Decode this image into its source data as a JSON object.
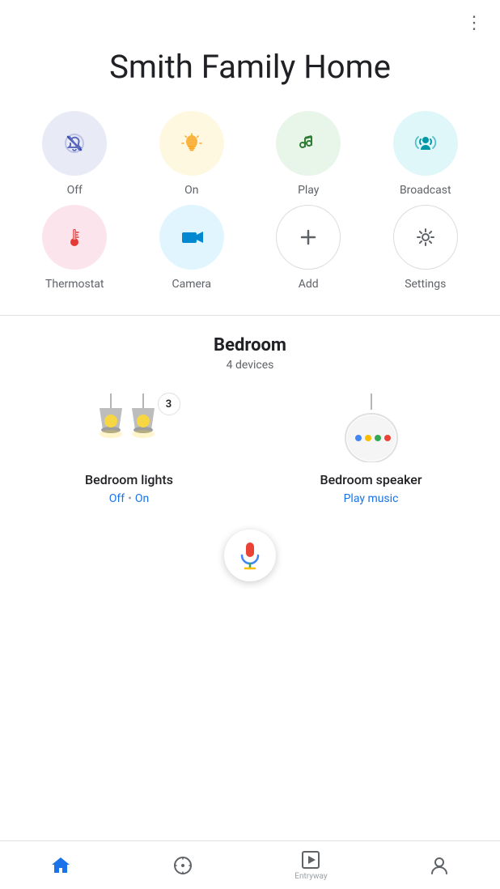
{
  "app": {
    "title": "Smith Family Home"
  },
  "quick_actions": [
    {
      "id": "off",
      "label": "Off",
      "circle_class": "circle-off",
      "icon": "off-icon"
    },
    {
      "id": "on",
      "label": "On",
      "circle_class": "circle-on",
      "icon": "on-icon"
    },
    {
      "id": "play",
      "label": "Play",
      "circle_class": "circle-play",
      "icon": "play-icon"
    },
    {
      "id": "broadcast",
      "label": "Broadcast",
      "circle_class": "circle-broadcast",
      "icon": "broadcast-icon"
    },
    {
      "id": "thermostat",
      "label": "Thermostat",
      "circle_class": "circle-thermostat",
      "icon": "thermostat-icon"
    },
    {
      "id": "camera",
      "label": "Camera",
      "circle_class": "circle-camera",
      "icon": "camera-icon"
    },
    {
      "id": "add",
      "label": "Add",
      "circle_class": "circle-add",
      "icon": "add-icon"
    },
    {
      "id": "settings",
      "label": "Settings",
      "circle_class": "circle-settings",
      "icon": "settings-icon"
    }
  ],
  "room": {
    "name": "Bedroom",
    "device_count": "4 devices"
  },
  "devices": [
    {
      "id": "bedroom-lights",
      "name": "Bedroom lights",
      "status_off": "Off",
      "dot": "•",
      "status_on": "On",
      "badge": "3"
    },
    {
      "id": "bedroom-speaker",
      "name": "Bedroom speaker",
      "action": "Play music"
    }
  ],
  "nav": {
    "home_label": "Home",
    "explore_label": "Explore",
    "media_label": "Media",
    "account_label": "Account",
    "entryway": "Entryway"
  }
}
